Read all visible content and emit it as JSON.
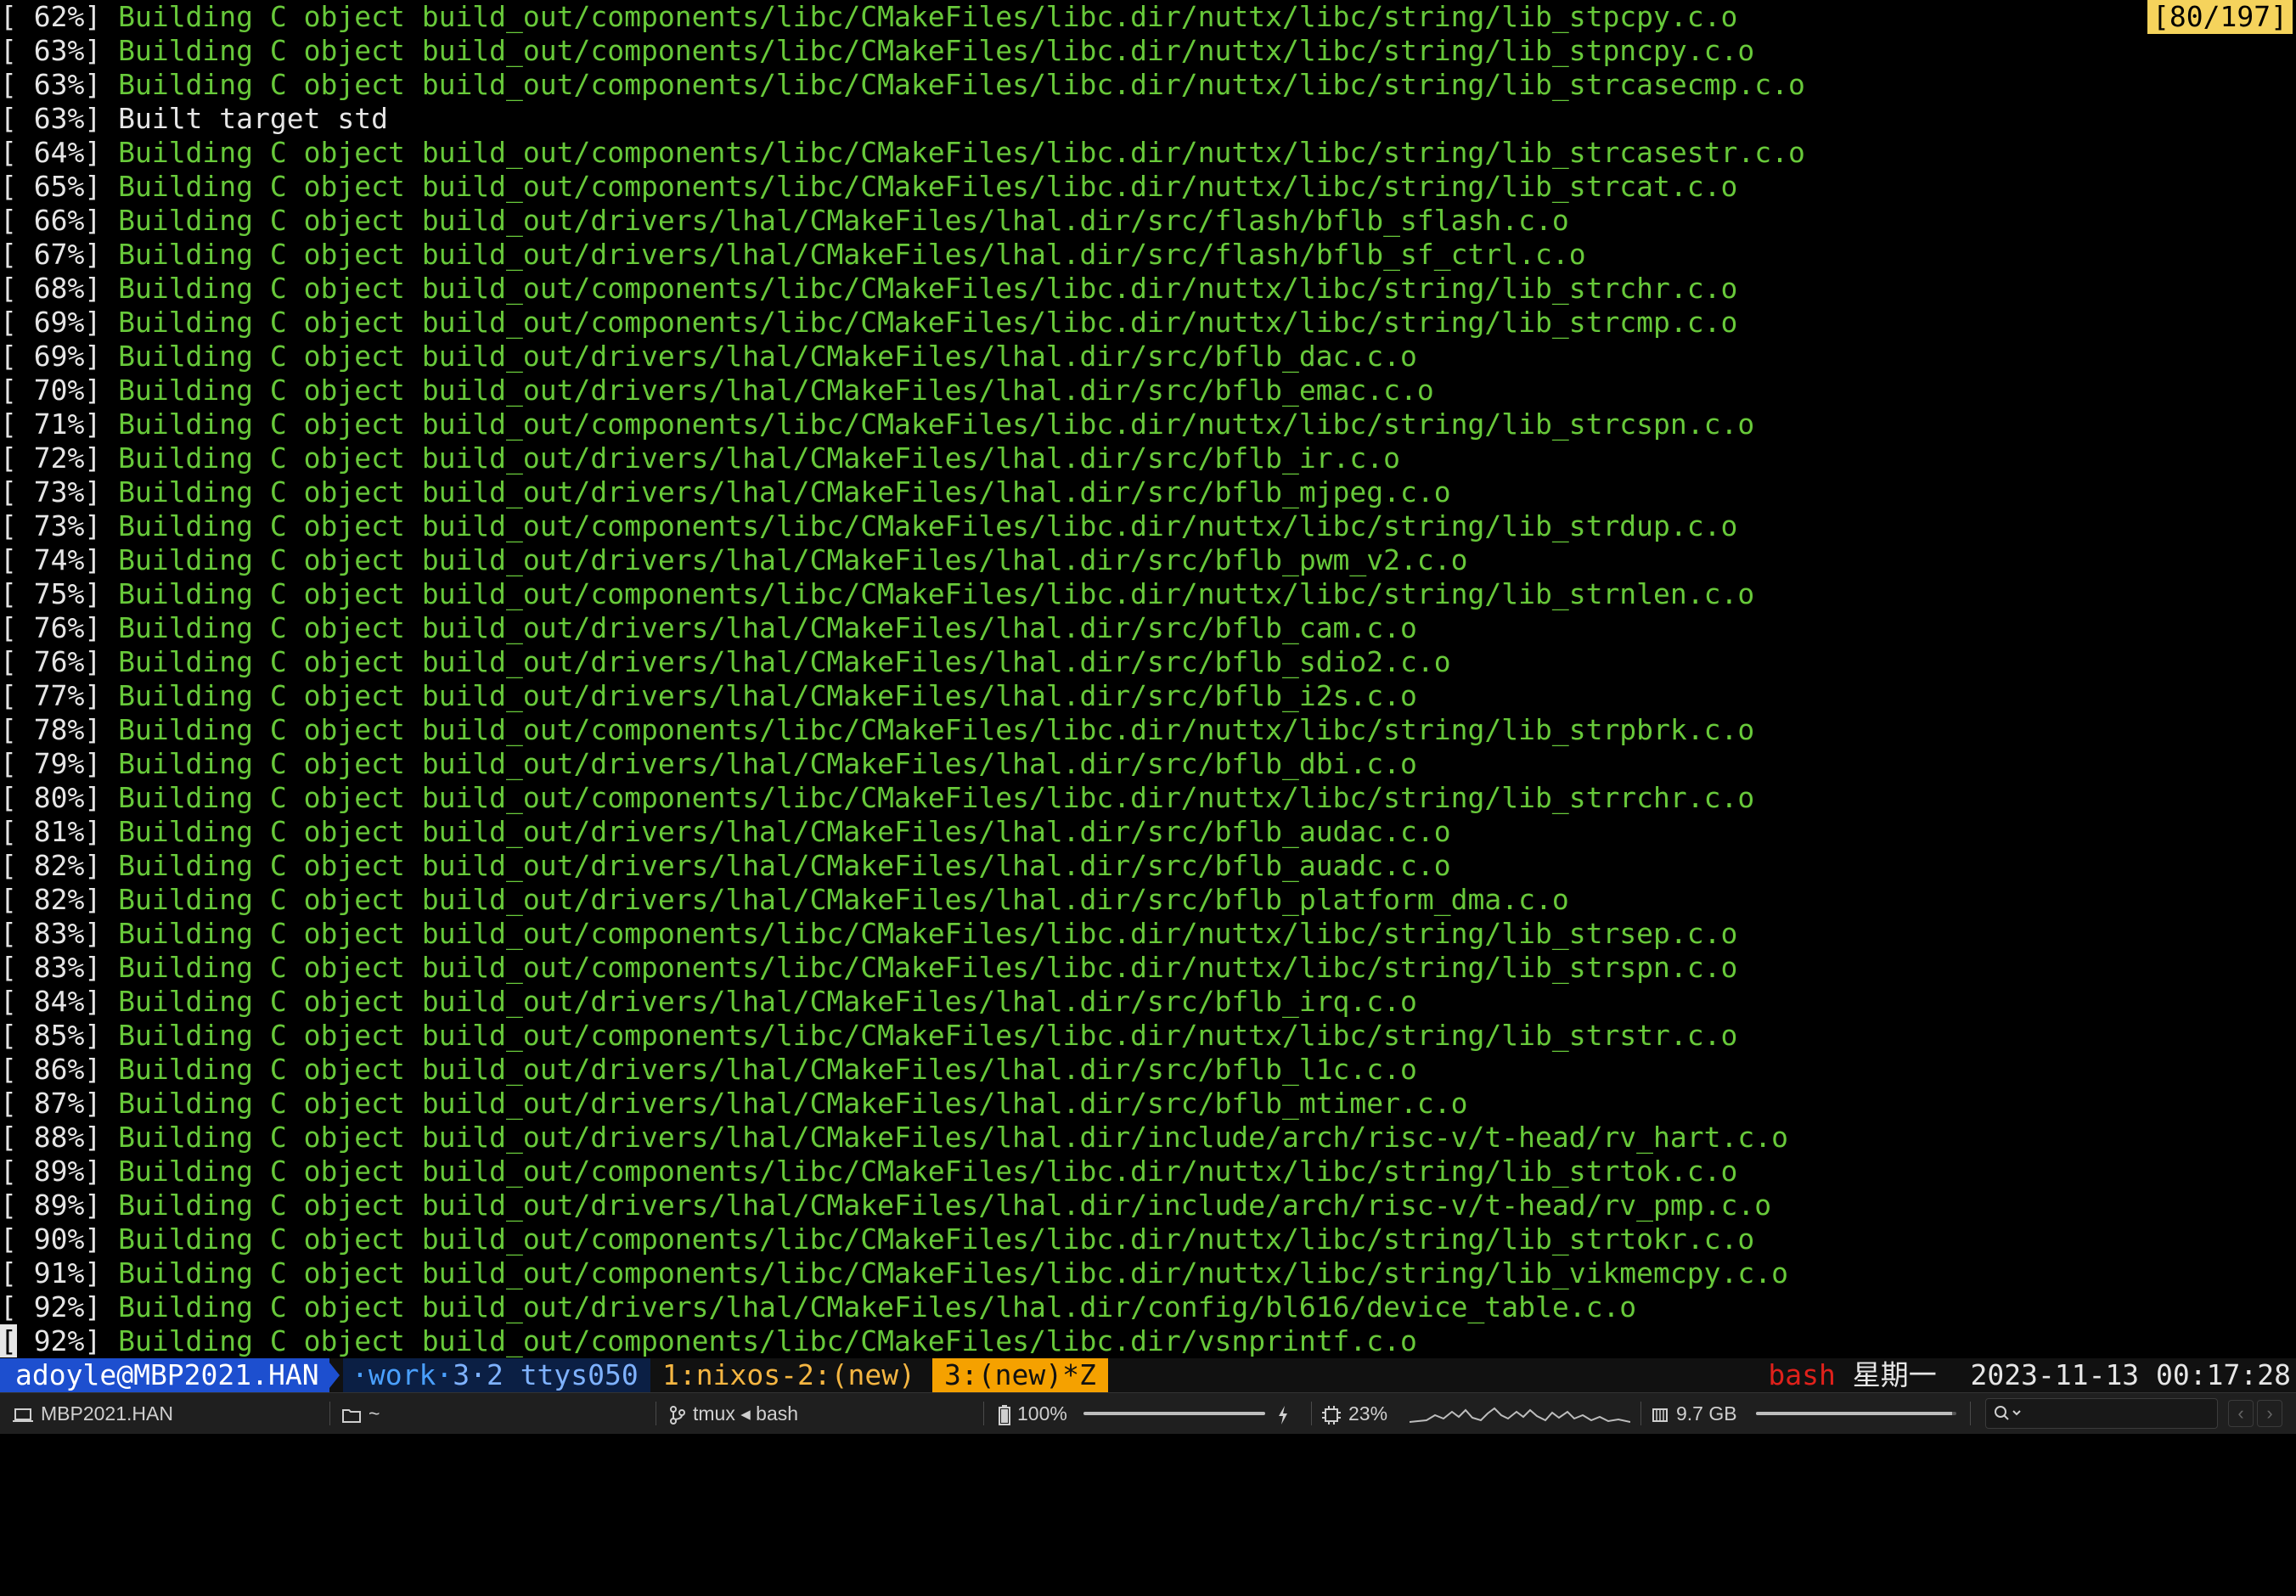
{
  "terminal": {
    "scroll_indicator": "[80/197]",
    "lines": [
      {
        "pct": "[ 62%]",
        "msg": " Building C object build_out/components/libc/CMakeFiles/libc.dir/nuttx/libc/string/lib_stpcpy.c.o"
      },
      {
        "pct": "[ 63%]",
        "msg": " Building C object build_out/components/libc/CMakeFiles/libc.dir/nuttx/libc/string/lib_stpncpy.c.o"
      },
      {
        "pct": "[ 63%]",
        "msg": " Building C object build_out/components/libc/CMakeFiles/libc.dir/nuttx/libc/string/lib_strcasecmp.c.o"
      },
      {
        "pct": "[ 63%]",
        "msg": " Built target std",
        "plain": true
      },
      {
        "pct": "[ 64%]",
        "msg": " Building C object build_out/components/libc/CMakeFiles/libc.dir/nuttx/libc/string/lib_strcasestr.c.o"
      },
      {
        "pct": "[ 65%]",
        "msg": " Building C object build_out/components/libc/CMakeFiles/libc.dir/nuttx/libc/string/lib_strcat.c.o"
      },
      {
        "pct": "[ 66%]",
        "msg": " Building C object build_out/drivers/lhal/CMakeFiles/lhal.dir/src/flash/bflb_sflash.c.o"
      },
      {
        "pct": "[ 67%]",
        "msg": " Building C object build_out/drivers/lhal/CMakeFiles/lhal.dir/src/flash/bflb_sf_ctrl.c.o"
      },
      {
        "pct": "[ 68%]",
        "msg": " Building C object build_out/components/libc/CMakeFiles/libc.dir/nuttx/libc/string/lib_strchr.c.o"
      },
      {
        "pct": "[ 69%]",
        "msg": " Building C object build_out/components/libc/CMakeFiles/libc.dir/nuttx/libc/string/lib_strcmp.c.o"
      },
      {
        "pct": "[ 69%]",
        "msg": " Building C object build_out/drivers/lhal/CMakeFiles/lhal.dir/src/bflb_dac.c.o"
      },
      {
        "pct": "[ 70%]",
        "msg": " Building C object build_out/drivers/lhal/CMakeFiles/lhal.dir/src/bflb_emac.c.o"
      },
      {
        "pct": "[ 71%]",
        "msg": " Building C object build_out/components/libc/CMakeFiles/libc.dir/nuttx/libc/string/lib_strcspn.c.o"
      },
      {
        "pct": "[ 72%]",
        "msg": " Building C object build_out/drivers/lhal/CMakeFiles/lhal.dir/src/bflb_ir.c.o"
      },
      {
        "pct": "[ 73%]",
        "msg": " Building C object build_out/drivers/lhal/CMakeFiles/lhal.dir/src/bflb_mjpeg.c.o"
      },
      {
        "pct": "[ 73%]",
        "msg": " Building C object build_out/components/libc/CMakeFiles/libc.dir/nuttx/libc/string/lib_strdup.c.o"
      },
      {
        "pct": "[ 74%]",
        "msg": " Building C object build_out/drivers/lhal/CMakeFiles/lhal.dir/src/bflb_pwm_v2.c.o"
      },
      {
        "pct": "[ 75%]",
        "msg": " Building C object build_out/components/libc/CMakeFiles/libc.dir/nuttx/libc/string/lib_strnlen.c.o"
      },
      {
        "pct": "[ 76%]",
        "msg": " Building C object build_out/drivers/lhal/CMakeFiles/lhal.dir/src/bflb_cam.c.o"
      },
      {
        "pct": "[ 76%]",
        "msg": " Building C object build_out/drivers/lhal/CMakeFiles/lhal.dir/src/bflb_sdio2.c.o"
      },
      {
        "pct": "[ 77%]",
        "msg": " Building C object build_out/drivers/lhal/CMakeFiles/lhal.dir/src/bflb_i2s.c.o"
      },
      {
        "pct": "[ 78%]",
        "msg": " Building C object build_out/components/libc/CMakeFiles/libc.dir/nuttx/libc/string/lib_strpbrk.c.o"
      },
      {
        "pct": "[ 79%]",
        "msg": " Building C object build_out/drivers/lhal/CMakeFiles/lhal.dir/src/bflb_dbi.c.o"
      },
      {
        "pct": "[ 80%]",
        "msg": " Building C object build_out/components/libc/CMakeFiles/libc.dir/nuttx/libc/string/lib_strrchr.c.o"
      },
      {
        "pct": "[ 81%]",
        "msg": " Building C object build_out/drivers/lhal/CMakeFiles/lhal.dir/src/bflb_audac.c.o"
      },
      {
        "pct": "[ 82%]",
        "msg": " Building C object build_out/drivers/lhal/CMakeFiles/lhal.dir/src/bflb_auadc.c.o"
      },
      {
        "pct": "[ 82%]",
        "msg": " Building C object build_out/drivers/lhal/CMakeFiles/lhal.dir/src/bflb_platform_dma.c.o"
      },
      {
        "pct": "[ 83%]",
        "msg": " Building C object build_out/components/libc/CMakeFiles/libc.dir/nuttx/libc/string/lib_strsep.c.o"
      },
      {
        "pct": "[ 83%]",
        "msg": " Building C object build_out/components/libc/CMakeFiles/libc.dir/nuttx/libc/string/lib_strspn.c.o"
      },
      {
        "pct": "[ 84%]",
        "msg": " Building C object build_out/drivers/lhal/CMakeFiles/lhal.dir/src/bflb_irq.c.o"
      },
      {
        "pct": "[ 85%]",
        "msg": " Building C object build_out/components/libc/CMakeFiles/libc.dir/nuttx/libc/string/lib_strstr.c.o"
      },
      {
        "pct": "[ 86%]",
        "msg": " Building C object build_out/drivers/lhal/CMakeFiles/lhal.dir/src/bflb_l1c.c.o"
      },
      {
        "pct": "[ 87%]",
        "msg": " Building C object build_out/drivers/lhal/CMakeFiles/lhal.dir/src/bflb_mtimer.c.o"
      },
      {
        "pct": "[ 88%]",
        "msg": " Building C object build_out/drivers/lhal/CMakeFiles/lhal.dir/include/arch/risc-v/t-head/rv_hart.c.o"
      },
      {
        "pct": "[ 89%]",
        "msg": " Building C object build_out/components/libc/CMakeFiles/libc.dir/nuttx/libc/string/lib_strtok.c.o"
      },
      {
        "pct": "[ 89%]",
        "msg": " Building C object build_out/drivers/lhal/CMakeFiles/lhal.dir/include/arch/risc-v/t-head/rv_pmp.c.o"
      },
      {
        "pct": "[ 90%]",
        "msg": " Building C object build_out/components/libc/CMakeFiles/libc.dir/nuttx/libc/string/lib_strtokr.c.o"
      },
      {
        "pct": "[ 91%]",
        "msg": " Building C object build_out/components/libc/CMakeFiles/libc.dir/nuttx/libc/string/lib_vikmemcpy.c.o"
      },
      {
        "pct": "[ 92%]",
        "msg": " Building C object build_out/drivers/lhal/CMakeFiles/lhal.dir/config/bl616/device_table.c.o"
      },
      {
        "pct": "[ 92%]",
        "msg": " Building C object build_out/components/libc/CMakeFiles/libc.dir/vsnprintf.c.o",
        "cursor": true
      }
    ]
  },
  "tmux": {
    "session": "adoyle@MBP2021.HAN",
    "work_label": "·work·",
    "pane_info": "3·2 ttys050",
    "window_1": "1:nixos-2:(new)",
    "window_3": "3:(new)*Z",
    "shell": "bash",
    "weekday": "星期一",
    "datetime": "2023-11-13 00:17:28"
  },
  "status_bar": {
    "host": "MBP2021.HAN",
    "path": "~",
    "process": "tmux ◂ bash",
    "battery": "100%",
    "battery_level": 1.0,
    "cpu": "23%",
    "memory": "9.7 GB",
    "memory_level": 0.98,
    "icons": {
      "host": "laptop-icon",
      "path": "folder-icon",
      "process": "branch-icon",
      "battery": "battery-icon",
      "charging": "lightning-icon",
      "cpu": "cpu-chip-icon",
      "memory": "memory-icon",
      "search": "search-icon"
    }
  },
  "colors": {
    "build_text": "#68c93a",
    "plain_text": "#e6e6e6",
    "session_bg": "#1d4fcf",
    "active_window_bg": "#f5a100",
    "scroll_indicator_bg": "#f5d35c",
    "shell_name": "#e0211b"
  }
}
